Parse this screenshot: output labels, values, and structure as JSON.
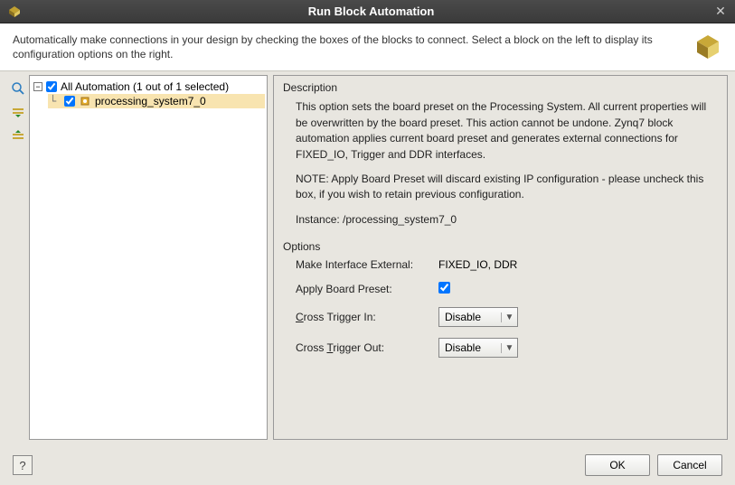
{
  "titlebar": {
    "title": "Run Block Automation"
  },
  "header": {
    "text": "Automatically make connections in your design by checking the boxes of the blocks to connect. Select a block on the left to display its configuration options on the right."
  },
  "tree": {
    "root_label": "All Automation (1 out of 1 selected)",
    "root_checked": true,
    "child_label": "processing_system7_0",
    "child_checked": true
  },
  "description": {
    "title": "Description",
    "para1": "This option sets the board preset on the Processing System. All current properties will be overwritten by the board preset. This action cannot be undone. Zynq7 block automation applies current board preset and generates external connections for FIXED_IO, Trigger and DDR interfaces.",
    "para2": "NOTE: Apply Board Preset will discard existing IP configuration - please uncheck this box, if you wish to retain previous configuration.",
    "instance_label": "Instance:  /processing_system7_0"
  },
  "options": {
    "title": "Options",
    "make_interface_external_label": "Make Interface External:",
    "make_interface_external_value": "FIXED_IO, DDR",
    "apply_board_preset_label": "Apply Board Preset:",
    "apply_board_preset_checked": true,
    "cross_trigger_in_label_pre": "C",
    "cross_trigger_in_label_post": "ross Trigger In:",
    "cross_trigger_in_value": "Disable",
    "cross_trigger_out_label_pre": "Cross ",
    "cross_trigger_out_label_u": "T",
    "cross_trigger_out_label_post": "rigger Out:",
    "cross_trigger_out_value": "Disable"
  },
  "buttons": {
    "help": "?",
    "ok": "OK",
    "cancel": "Cancel"
  }
}
